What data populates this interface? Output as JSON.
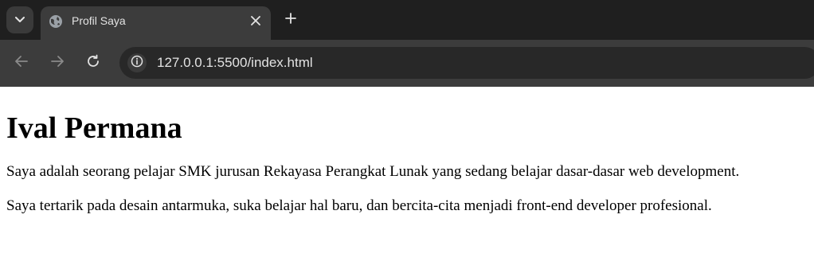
{
  "browser": {
    "tab": {
      "title": "Profil Saya",
      "favicon": "globe-icon"
    },
    "address_bar": {
      "url": "127.0.0.1:5500/index.html"
    }
  },
  "page": {
    "heading": "Ival Permana",
    "paragraphs": [
      "Saya adalah seorang pelajar SMK jurusan Rekayasa Perangkat Lunak yang sedang belajar dasar-dasar web development.",
      "Saya tertarik pada desain antarmuka, suka belajar hal baru, dan bercita-cita menjadi front-end developer profesional."
    ]
  }
}
